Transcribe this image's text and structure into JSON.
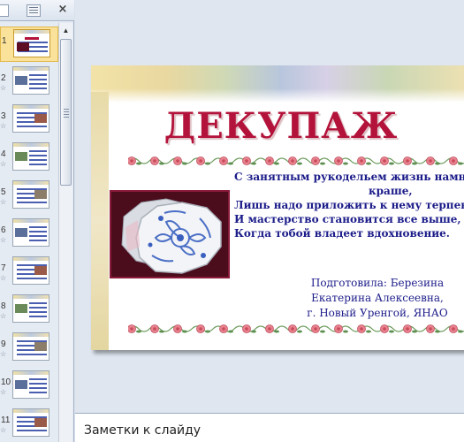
{
  "panel": {
    "close_glyph": "×",
    "slides": [
      {
        "num": "1",
        "selected": true
      },
      {
        "num": "2"
      },
      {
        "num": "3"
      },
      {
        "num": "4"
      },
      {
        "num": "5"
      },
      {
        "num": "6"
      },
      {
        "num": "7"
      },
      {
        "num": "8"
      },
      {
        "num": "9"
      },
      {
        "num": "10"
      },
      {
        "num": "11"
      }
    ]
  },
  "slide": {
    "title": "ДЕКУПАЖ",
    "poem": [
      "С занятным рукодельем жизнь намного",
      "краше,",
      "Лишь надо приложить к нему терпенье",
      "И мастерство становится все выше,",
      "Когда  тобой владеет вдохновение."
    ],
    "author": [
      "Подготовила:  Березина",
      "Екатерина  Алексеевна,",
      "г. Новый  Уренгой,  ЯНАО"
    ]
  },
  "notes": {
    "placeholder": "Заметки к слайду"
  },
  "colors": {
    "title": "#b3123a",
    "text": "#1c1c8a",
    "selected_thumb": "#fbe29a"
  }
}
